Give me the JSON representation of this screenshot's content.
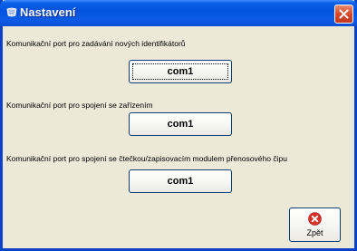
{
  "window": {
    "title": "Nastavení"
  },
  "sections": [
    {
      "label": "Komunikační port pro zadávání nových identifikátorů",
      "port": "com1"
    },
    {
      "label": "Komunikační port pro spojení se zařízením",
      "port": "com1"
    },
    {
      "label": "Komunikační port pro spojení se čtečkou/zapisovacím modulem přenosového čipu",
      "port": "com1"
    }
  ],
  "back_button": {
    "label": "Zpět",
    "icon": "error-circle-icon"
  },
  "colors": {
    "titlebar": "#0454e0",
    "window_frame": "#0842c8",
    "client_bg": "#ece9d8",
    "close_button": "#d8482a",
    "back_icon": "#d8302a"
  }
}
